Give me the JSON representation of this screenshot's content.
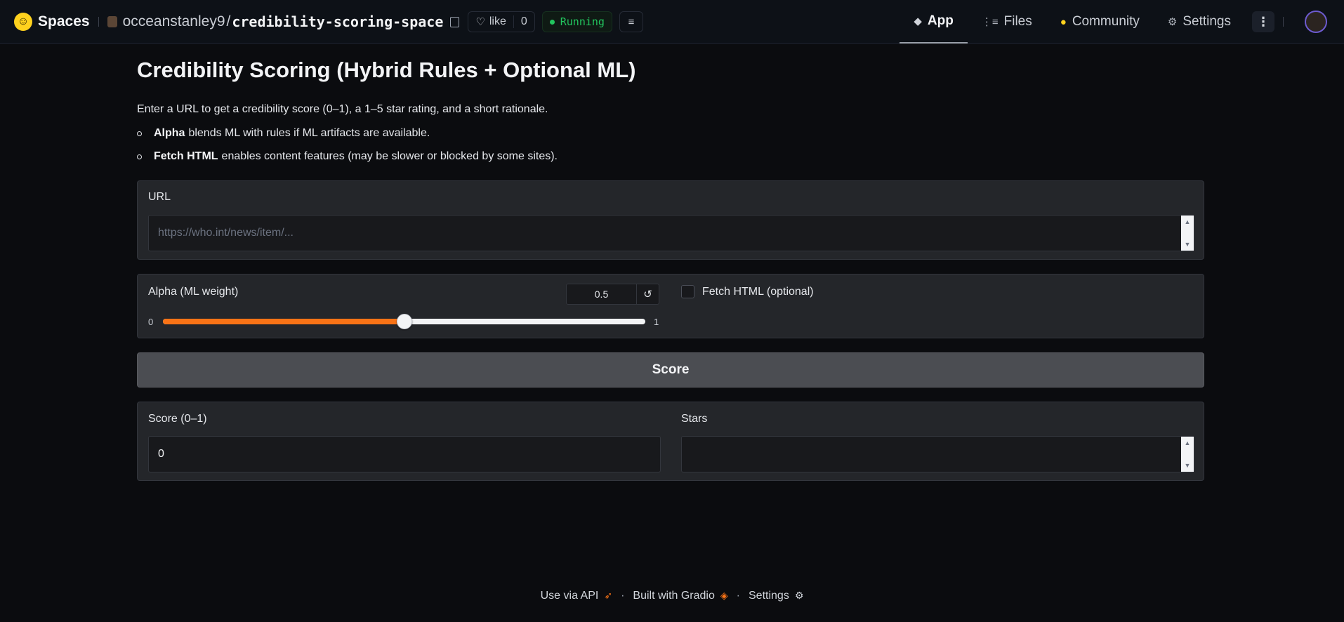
{
  "header": {
    "brand": "Spaces",
    "owner": "occeanstanley9",
    "separator": "/",
    "space_name": "credibility-scoring-space",
    "like_label": "like",
    "like_count": "0",
    "status": "Running",
    "status_color": "#22c55e",
    "tabs": [
      {
        "label": "App",
        "icon": "cube-icon",
        "active": true
      },
      {
        "label": "Files",
        "icon": "files-icon",
        "active": false
      },
      {
        "label": "Community",
        "icon": "community-icon",
        "active": false
      },
      {
        "label": "Settings",
        "icon": "gear-icon",
        "active": false
      }
    ]
  },
  "main": {
    "title": "Credibility Scoring (Hybrid Rules + Optional ML)",
    "intro": "Enter a URL to get a credibility score (0–1), a 1–5 star rating, and a short rationale.",
    "bullets": [
      {
        "bold": "Alpha",
        "text": "blends ML with rules if ML artifacts are available."
      },
      {
        "bold": "Fetch HTML",
        "text": "enables content features (may be slower or blocked by some sites)."
      }
    ],
    "url": {
      "label": "URL",
      "placeholder": "https://who.int/news/item/...",
      "value": ""
    },
    "alpha": {
      "label": "Alpha (ML weight)",
      "value": "0.5",
      "min_label": "0",
      "max_label": "1",
      "fraction": 0.5,
      "accent": "#f97316"
    },
    "fetch_html": {
      "label": "Fetch HTML (optional)",
      "checked": false
    },
    "score_button": "Score",
    "outputs": {
      "score_label": "Score (0–1)",
      "score_value": "0",
      "stars_label": "Stars",
      "stars_value": ""
    }
  },
  "footer": {
    "api": "Use via API",
    "built": "Built with Gradio",
    "settings": "Settings",
    "separator": "·"
  }
}
